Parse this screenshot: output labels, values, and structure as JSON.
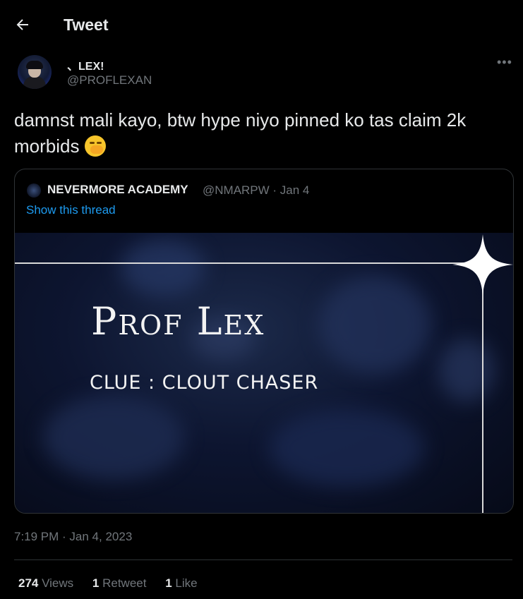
{
  "header": {
    "title": "Tweet"
  },
  "author": {
    "display_name": "、LEX!",
    "handle": "@PROFLEXAN"
  },
  "tweet": {
    "text": "damnst mali kayo, btw hype niyo pinned ko tas claim 2k morbids"
  },
  "quote": {
    "name": "NEVERMORE ACADEMY",
    "handle_date": "@NMARPW · Jan 4",
    "show_thread": "Show this thread",
    "media": {
      "title": "Prof Lex",
      "subtitle": "CLUE : CLOUT CHASER"
    }
  },
  "timestamp": "7:19 PM · Jan 4, 2023",
  "stats": {
    "views_count": "274",
    "views_label": "Views",
    "retweets_count": "1",
    "retweets_label": "Retweet",
    "likes_count": "1",
    "likes_label": "Like"
  },
  "icons": {
    "back": "arrow-left-icon",
    "more": "more-icon",
    "emoji": "face-with-hand-over-mouth-emoji"
  },
  "colors": {
    "background": "#000000",
    "text": "#e7e9ea",
    "muted": "#71767b",
    "link": "#1d9bf0",
    "border": "#2f3336"
  }
}
